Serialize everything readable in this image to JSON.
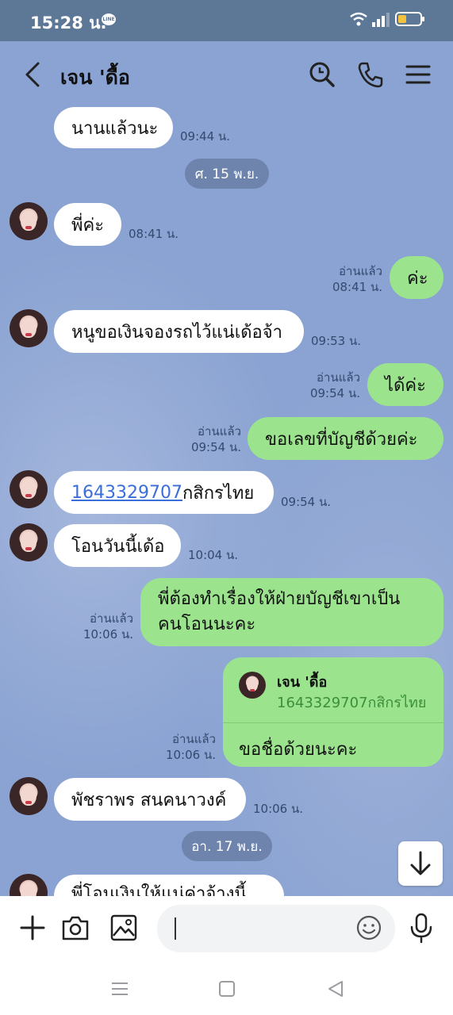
{
  "status": {
    "time": "15:28 น.",
    "line_badge": "LINE"
  },
  "header": {
    "title": "เจน 'ดื้อ"
  },
  "messages": {
    "m1": {
      "text": "นานแล้วนะ",
      "time": "09:44 น."
    },
    "date1": "ศ. 15 พ.ย.",
    "m2": {
      "text": "พี่ค่ะ",
      "time": "08:41 น."
    },
    "m3": {
      "text": "ค่ะ",
      "read": "อ่านแล้ว",
      "time": "08:41 น."
    },
    "m4": {
      "text": "หนูขอเงินจองรถไว้แน่เด้อจ้า",
      "time": "09:53 น."
    },
    "m5": {
      "text": "ได้ค่ะ",
      "read": "อ่านแล้ว",
      "time": "09:54 น."
    },
    "m6": {
      "text": "ขอเลขที่บัญชีด้วยค่ะ",
      "read": "อ่านแล้ว",
      "time": "09:54 น."
    },
    "m7": {
      "link": "1643329707",
      "text": "กสิกรไทย",
      "time": "09:54 น."
    },
    "m8": {
      "text": "โอนวันนี้เด้อ",
      "time": "10:04 น."
    },
    "m9": {
      "line1": "พี่ต้องทำเรื่องให้ฝ่ายบัญชีเขาเป็น",
      "line2": "คนโอนนะคะ",
      "read": "อ่านแล้ว",
      "time": "10:06 น."
    },
    "m10": {
      "quote_name": "เจน 'ดื้อ",
      "quote_text": "1643329707กสิกรไทย",
      "text": "ขอชื่อด้วยนะคะ",
      "read": "อ่านแล้ว",
      "time": "10:06 น."
    },
    "m11": {
      "text": "พัชราพร สนคนาวงค์",
      "time": "10:06 น."
    },
    "date2": "อา. 17 พ.ย.",
    "m12": {
      "text": "พี่โอนเงินให้แน่ค่าจ้างนี้"
    }
  },
  "input": {
    "placeholder": ""
  },
  "colors": {
    "chat_bg": "#8aa3d2",
    "incoming": "#ffffff",
    "outgoing": "#9be48d",
    "status_bar": "#5d7796"
  }
}
